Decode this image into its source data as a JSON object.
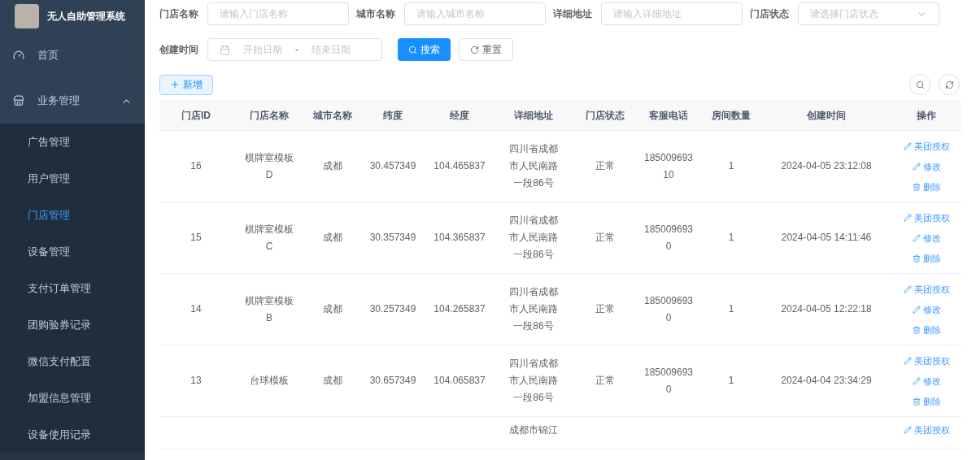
{
  "app": {
    "title": "无人自助管理系统"
  },
  "sidebar": {
    "items": [
      {
        "label": "首页",
        "kind": "link",
        "selected": false
      },
      {
        "label": "业务管理",
        "kind": "group",
        "expanded": true,
        "children": [
          {
            "label": "广告管理",
            "selected": false
          },
          {
            "label": "用户管理",
            "selected": false
          },
          {
            "label": "门店管理",
            "selected": true
          },
          {
            "label": "设备管理",
            "selected": false
          },
          {
            "label": "支付订单管理",
            "selected": false
          },
          {
            "label": "团购验券记录",
            "selected": false
          },
          {
            "label": "微信支付配置",
            "selected": false
          },
          {
            "label": "加盟信息管理",
            "selected": false
          },
          {
            "label": "设备使用记录",
            "selected": false
          }
        ]
      }
    ]
  },
  "filters": [
    {
      "label": "门店名称",
      "kind": "input",
      "placeholder": "请输入门店名称"
    },
    {
      "label": "城市名称",
      "kind": "input",
      "placeholder": "请输入城市名称"
    },
    {
      "label": "详细地址",
      "kind": "input",
      "placeholder": "请输入详细地址"
    },
    {
      "label": "门店状态",
      "kind": "select",
      "placeholder": "请选择门店状态"
    },
    {
      "label": "创建时间",
      "kind": "daterange",
      "start_placeholder": "开始日期",
      "separator": "-",
      "end_placeholder": "结束日期"
    }
  ],
  "search_button": "搜索",
  "reset_button": "重置",
  "add_button": "新增",
  "table": {
    "columns": [
      "门店ID",
      "门店名称",
      "城市名称",
      "纬度",
      "经度",
      "详细地址",
      "门店状态",
      "客服电话",
      "房间数量",
      "创建时间",
      "操作"
    ],
    "rows": [
      {
        "id": "16",
        "name": "棋牌室模板D",
        "city": "成都",
        "lat": "30.457349",
        "lng": "104.465837",
        "address": "四川省成都市人民南路一段86号",
        "status": "正常",
        "phone": "18500969310",
        "rooms": "1",
        "created": "2024-04-05 23:12:08",
        "actions": [
          "美团授权",
          "修改",
          "删除"
        ]
      },
      {
        "id": "15",
        "name": "棋牌室模板C",
        "city": "成都",
        "lat": "30.357349",
        "lng": "104.365837",
        "address": "四川省成都市人民南路一段86号",
        "status": "正常",
        "phone": "1850096930",
        "rooms": "1",
        "created": "2024-04-05 14:11:46",
        "actions": [
          "美团授权",
          "修改",
          "删除"
        ]
      },
      {
        "id": "14",
        "name": "棋牌室模板B",
        "city": "成都",
        "lat": "30.257349",
        "lng": "104.265837",
        "address": "四川省成都市人民南路一段86号",
        "status": "正常",
        "phone": "1850096930",
        "rooms": "1",
        "created": "2024-04-05 12:22:18",
        "actions": [
          "美团授权",
          "修改",
          "删除"
        ]
      },
      {
        "id": "13",
        "name": "台球模板",
        "city": "成都",
        "lat": "30.657349",
        "lng": "104.065837",
        "address": "四川省成都市人民南路一段86号",
        "status": "正常",
        "phone": "1850096930",
        "rooms": "1",
        "created": "2024-04-04 23:34:29",
        "actions": [
          "美团授权",
          "修改",
          "删除"
        ]
      },
      {
        "address": "成都市锦江",
        "actions": [
          "美团授权"
        ]
      }
    ]
  }
}
